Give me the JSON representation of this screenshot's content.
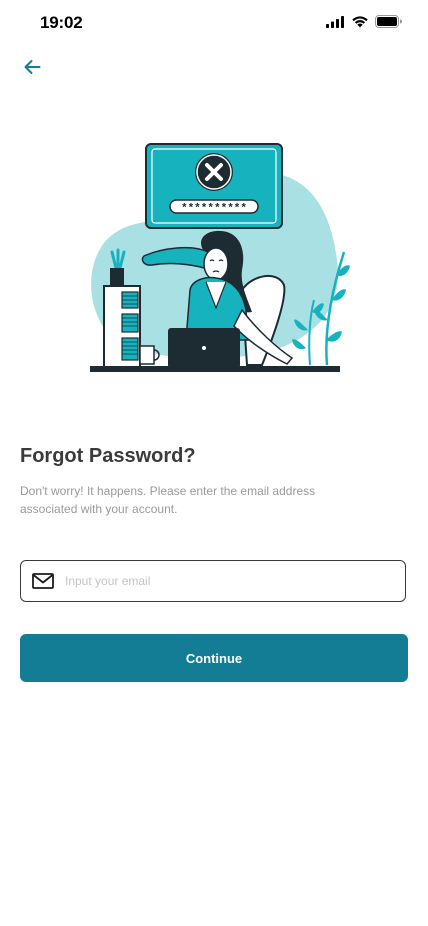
{
  "status_bar": {
    "time": "19:02"
  },
  "navigation": {
    "back_icon": "arrow-left-icon"
  },
  "illustration": {
    "masked_password": "**********",
    "icon": "error-x-icon"
  },
  "content": {
    "title": "Forgot Password?",
    "subtitle": "Don't worry! It happens. Please enter the email address associated with your account."
  },
  "email_field": {
    "icon": "mail-icon",
    "placeholder": "Input your email",
    "value": ""
  },
  "continue_button": {
    "label": "Continue"
  },
  "colors": {
    "primary": "#127d95",
    "accent_teal": "#16b3bf",
    "light_teal": "#a8e0e4",
    "dark_text": "#3b3b3b",
    "muted_text": "#9a9a9a"
  }
}
